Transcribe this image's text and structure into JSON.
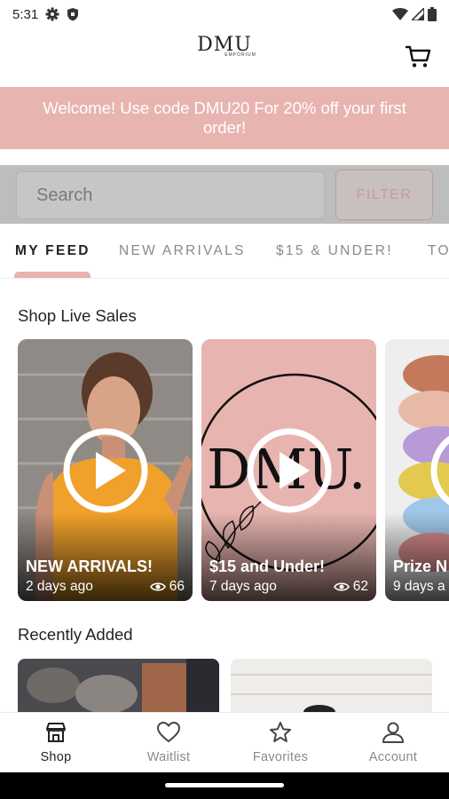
{
  "status_bar": {
    "time": "5:31"
  },
  "header": {
    "logo_text": "DMU",
    "logo_subtext": "EMPORIUM"
  },
  "promo": {
    "text": "Welcome! Use code DMU20 For 20% off your first order!"
  },
  "search": {
    "placeholder": "Search",
    "filter_label": "FILTER"
  },
  "tabs": [
    {
      "label": "MY FEED",
      "active": true
    },
    {
      "label": "NEW ARRIVALS"
    },
    {
      "label": "$15 & UNDER!"
    },
    {
      "label": "TO"
    }
  ],
  "live_sales": {
    "title": "Shop Live Sales",
    "cards": [
      {
        "title": "NEW ARRIVALS!",
        "date": "2 days ago",
        "views": "66"
      },
      {
        "title": "$15 and Under!",
        "date": "7 days ago",
        "views": "62"
      },
      {
        "title": "Prize N",
        "date": "9 days a"
      }
    ]
  },
  "recently_added": {
    "title": "Recently Added"
  },
  "bottom_nav": [
    {
      "label": "Shop",
      "icon": "storefront-icon",
      "active": true
    },
    {
      "label": "Waitlist",
      "icon": "heart-icon"
    },
    {
      "label": "Favorites",
      "icon": "star-icon"
    },
    {
      "label": "Account",
      "icon": "person-icon"
    }
  ],
  "colors": {
    "brand_pink": "#e8b4b0",
    "text_dark": "#222222",
    "text_muted": "#8a8a8a"
  }
}
